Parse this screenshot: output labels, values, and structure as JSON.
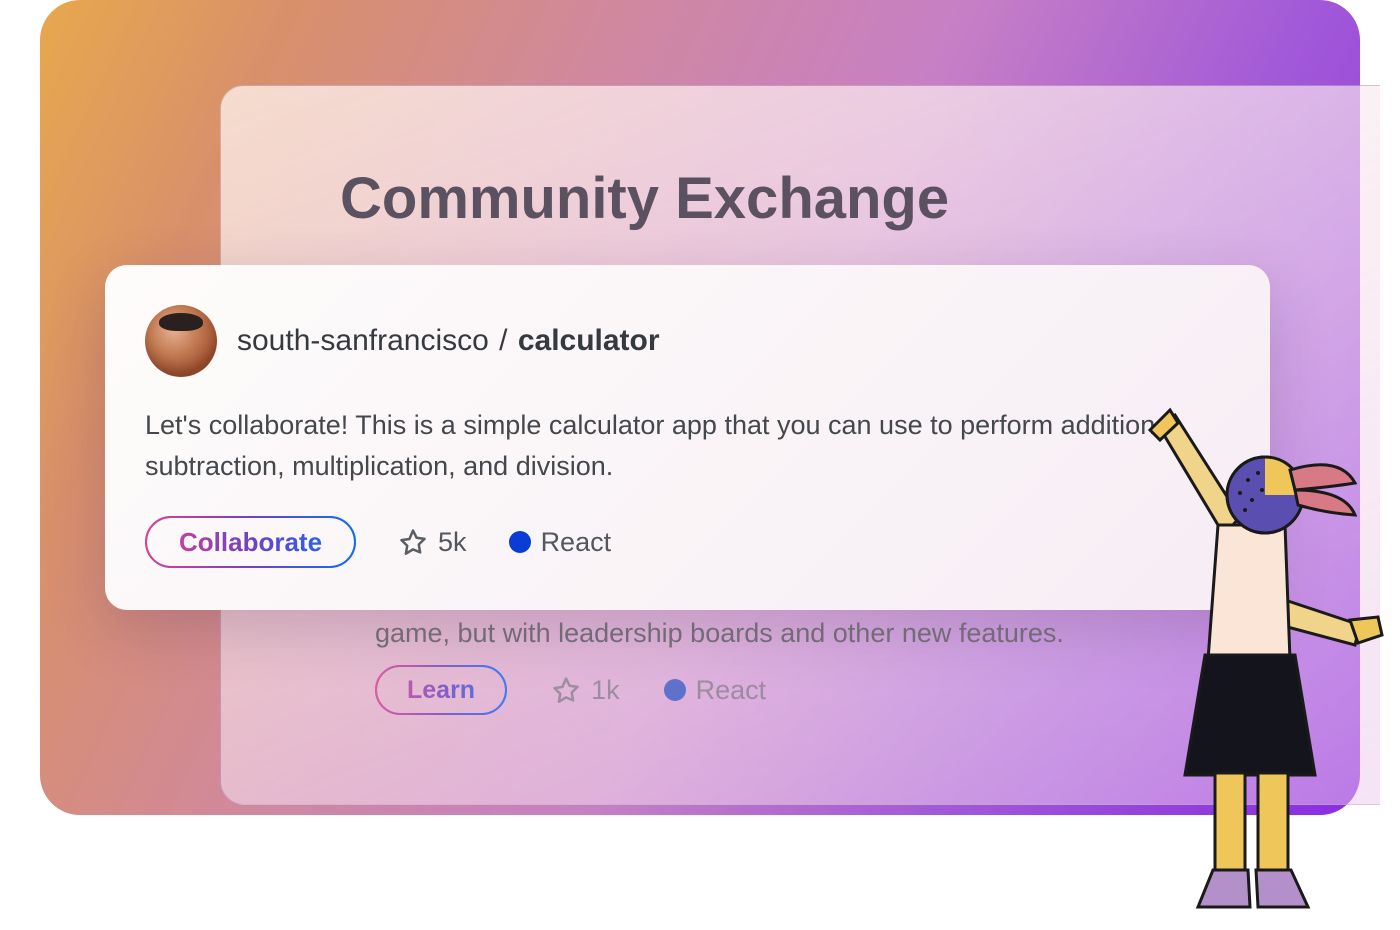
{
  "page": {
    "title": "Community Exchange"
  },
  "featured_card": {
    "owner": "south-sanfrancisco",
    "separator": "/",
    "repo": "calculator",
    "description": "Let's collaborate! This is a simple calculator app that you can use to perform addition, subtraction, multiplication, and division.",
    "button_label": "Collaborate",
    "stars": "5k",
    "language": "React",
    "language_color": "#0c3cd6"
  },
  "background_card": {
    "description_fragment": "game, but with leadership boards and other new features.",
    "button_label": "Learn",
    "stars": "1k",
    "language": "React",
    "language_color": "#3b5fc7"
  }
}
